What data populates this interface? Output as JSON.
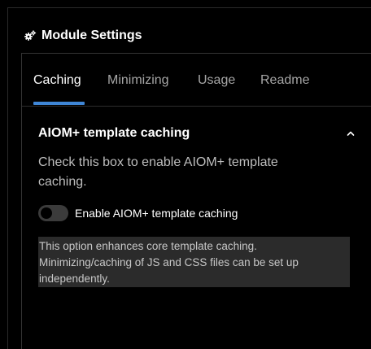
{
  "page": {
    "title": "Module Settings",
    "title_icon": "gears-icon"
  },
  "tabs": [
    {
      "label": "Caching",
      "active": true
    },
    {
      "label": "Minimizing",
      "active": false
    },
    {
      "label": "Usage",
      "active": false
    },
    {
      "label": "Readme",
      "active": false
    }
  ],
  "section": {
    "title": "AIOM+ template caching",
    "expanded": true,
    "collapse_icon": "chevron-up-icon",
    "description": "Check this box to enable AIOM+ template caching.",
    "toggle": {
      "label": "Enable AIOM+ template caching",
      "checked": false
    },
    "note": "This option enhances core template caching. Minimizing/caching of JS and CSS files can be set up independently."
  },
  "colors": {
    "background": "#000000",
    "accent": "#3f86d6",
    "note_bg": "#2b2b2b",
    "muted_text": "#a6a6a6"
  }
}
